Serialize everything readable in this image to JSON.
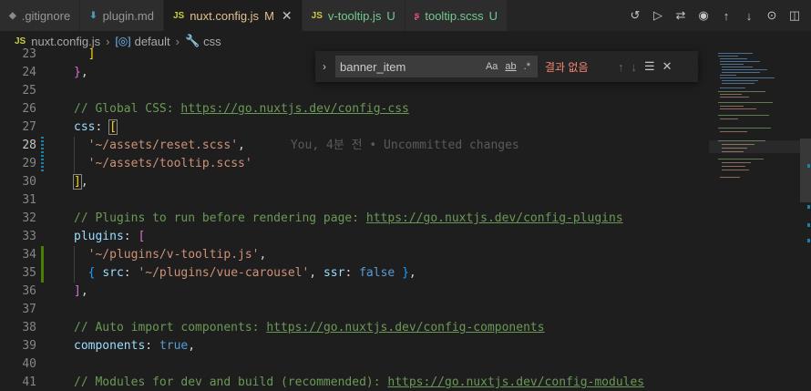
{
  "tabs": [
    {
      "icon": "git-icon",
      "icon_text": "◆",
      "label": ".gitignore",
      "status": "",
      "active": false,
      "class": ""
    },
    {
      "icon": "markdown-icon",
      "icon_text": "⬇",
      "label": "plugin.md",
      "status": "",
      "active": false,
      "class": ""
    },
    {
      "icon": "javascript-icon",
      "icon_text": "JS",
      "label": "nuxt.config.js",
      "status": "M",
      "active": true,
      "class": "modified-m"
    },
    {
      "icon": "javascript-icon",
      "icon_text": "JS",
      "label": "v-tooltip.js",
      "status": "U",
      "active": false,
      "class": "modified-u"
    },
    {
      "icon": "scss-icon",
      "icon_text": "ʂ",
      "label": "tooltip.scss",
      "status": "U",
      "active": false,
      "class": "modified-u"
    }
  ],
  "tab_close_glyph": "✕",
  "toolbar_icons": [
    "history-icon",
    "play-icon",
    "compare-icon",
    "commit-icon",
    "previous-change-icon",
    "next-change-icon",
    "blame-icon",
    "split-editor-icon"
  ],
  "breadcrumb": {
    "file_icon_text": "JS",
    "file": "nuxt.config.js",
    "symbol": "default",
    "property": "css"
  },
  "find": {
    "query": "banner_item",
    "match_case": "Aa",
    "whole_word": "ab",
    "regex": ".*",
    "result": "결과 없음"
  },
  "editor": {
    "blame": "You, 4분 전 • Uncommitted changes",
    "line_numbers": [
      "23",
      "24",
      "25",
      "26",
      "27",
      "28",
      "29",
      "30",
      "31",
      "32",
      "33",
      "34",
      "35",
      "36",
      "37",
      "38",
      "39",
      "40",
      "41"
    ],
    "comment_css": "// Global CSS: ",
    "url_css": "https://go.nuxtjs.dev/config-css",
    "comment_plugins": "// Plugins to run before rendering page: ",
    "url_plugins": "https://go.nuxtjs.dev/config-plugins",
    "comment_components": "// Auto import components: ",
    "url_components": "https://go.nuxtjs.dev/config-components",
    "comment_modules": "// Modules for dev and build (recommended): ",
    "url_modules": "https://go.nuxtjs.dev/config-modules",
    "key_css": "css",
    "key_plugins": "plugins",
    "key_components": "components",
    "str_reset": "'~/assets/reset.scss'",
    "str_tooltip": "'~/assets/tooltip.scss'",
    "str_vtooltip": "'~/plugins/v-tooltip.js'",
    "key_src": "src",
    "str_carousel": "'~/plugins/vue-carousel'",
    "key_ssr": "ssr",
    "val_false": "false",
    "val_true": "true"
  }
}
